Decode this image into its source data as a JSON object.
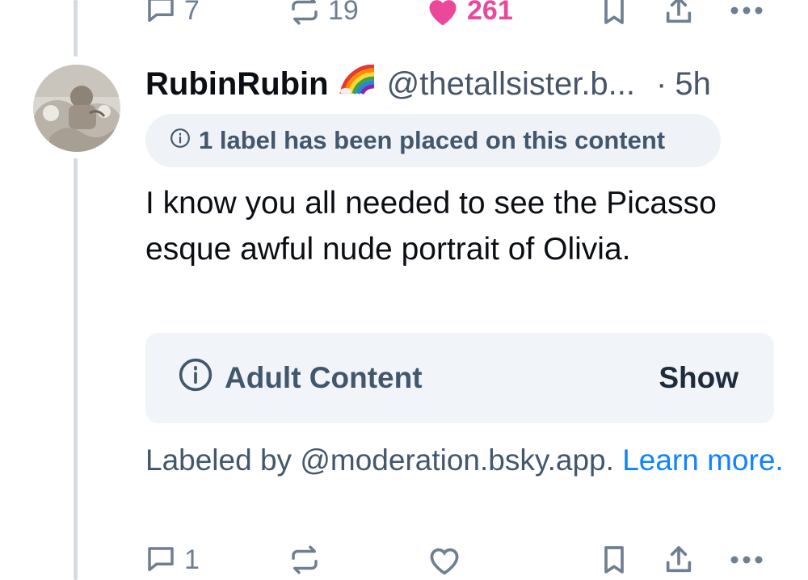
{
  "top_actions": {
    "reply_count": "7",
    "repost_count": "19",
    "like_count": "261"
  },
  "post": {
    "display_name": "RubinRubin",
    "handle": "@thetallsister.b...",
    "separator": "·",
    "timestamp": "5h",
    "label_notice": "1 label has been placed on this content",
    "text": "I know you all needed to see the Picasso esque awful nude portrait of Olivia.",
    "content_warning": {
      "title": "Adult Content",
      "show_label": "Show"
    },
    "labeled_by_prefix": "Labeled by @moderation.bsky.app. ",
    "learn_more": "Learn more."
  },
  "bottom_actions": {
    "reply_count": "1"
  },
  "colors": {
    "accent_blue": "#1083fe",
    "like_pink": "#ec4899",
    "muted_text": "#42576c",
    "pill_bg": "#eff2f6",
    "thread_line": "#d4dbe2"
  },
  "icons": [
    "reply-icon",
    "repost-icon",
    "like-icon",
    "bookmark-icon",
    "share-icon",
    "more-icon",
    "info-icon",
    "rainbow-icon"
  ]
}
